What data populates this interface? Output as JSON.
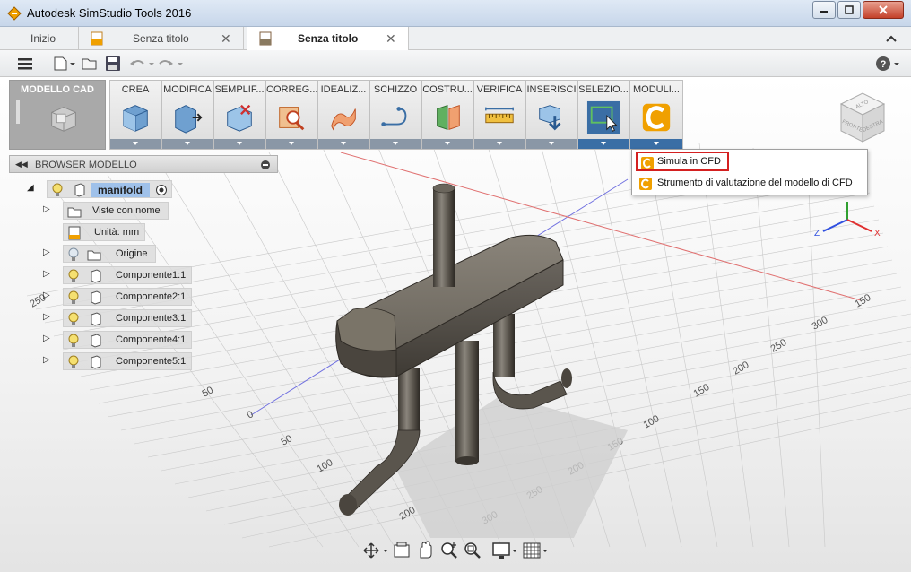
{
  "window": {
    "title": "Autodesk SimStudio Tools 2016"
  },
  "tabs": [
    {
      "label": "Inizio"
    },
    {
      "label": "Senza titolo"
    },
    {
      "label": "Senza titolo"
    }
  ],
  "ribbon": {
    "groups": [
      {
        "label": "MODELLO CAD"
      },
      {
        "label": "CREA"
      },
      {
        "label": "MODIFICA"
      },
      {
        "label": "SEMPLIF..."
      },
      {
        "label": "CORREG..."
      },
      {
        "label": "IDEALIZ..."
      },
      {
        "label": "SCHIZZO"
      },
      {
        "label": "COSTRU..."
      },
      {
        "label": "VERIFICA"
      },
      {
        "label": "INSERISCI"
      },
      {
        "label": "SELEZIO..."
      },
      {
        "label": "MODULI..."
      }
    ]
  },
  "dropdown": {
    "items": [
      {
        "label": "Simula in CFD"
      },
      {
        "label": "Strumento di valutazione del modello di CFD"
      }
    ]
  },
  "browser": {
    "title": "BROWSER MODELLO",
    "root": "manifold",
    "nodes": [
      {
        "label": "Viste con nome"
      },
      {
        "label": "Unità: mm"
      },
      {
        "label": "Origine"
      },
      {
        "label": "Componente1:1"
      },
      {
        "label": "Componente2:1"
      },
      {
        "label": "Componente3:1"
      },
      {
        "label": "Componente4:1"
      },
      {
        "label": "Componente5:1"
      }
    ]
  },
  "grid_labels": {
    "left": [
      "250",
      "200",
      "150",
      "100",
      "50",
      "0",
      "50",
      "100",
      "150",
      "200"
    ],
    "right": [
      "300",
      "250",
      "200",
      "150",
      "100",
      "50",
      "100",
      "150",
      "200",
      "250",
      "300",
      "150"
    ]
  },
  "viewcube": {
    "faces": [
      "ALTO",
      "FRONTE",
      "DESTRA"
    ],
    "axes": [
      "Z",
      "X"
    ]
  },
  "colors": {
    "accent": "#3a6ea5",
    "highlight_border": "#d42020",
    "grid_x_axis": "#e05050",
    "grid_y_axis": "#5050e0",
    "cfd_icon": "#f0a000"
  }
}
